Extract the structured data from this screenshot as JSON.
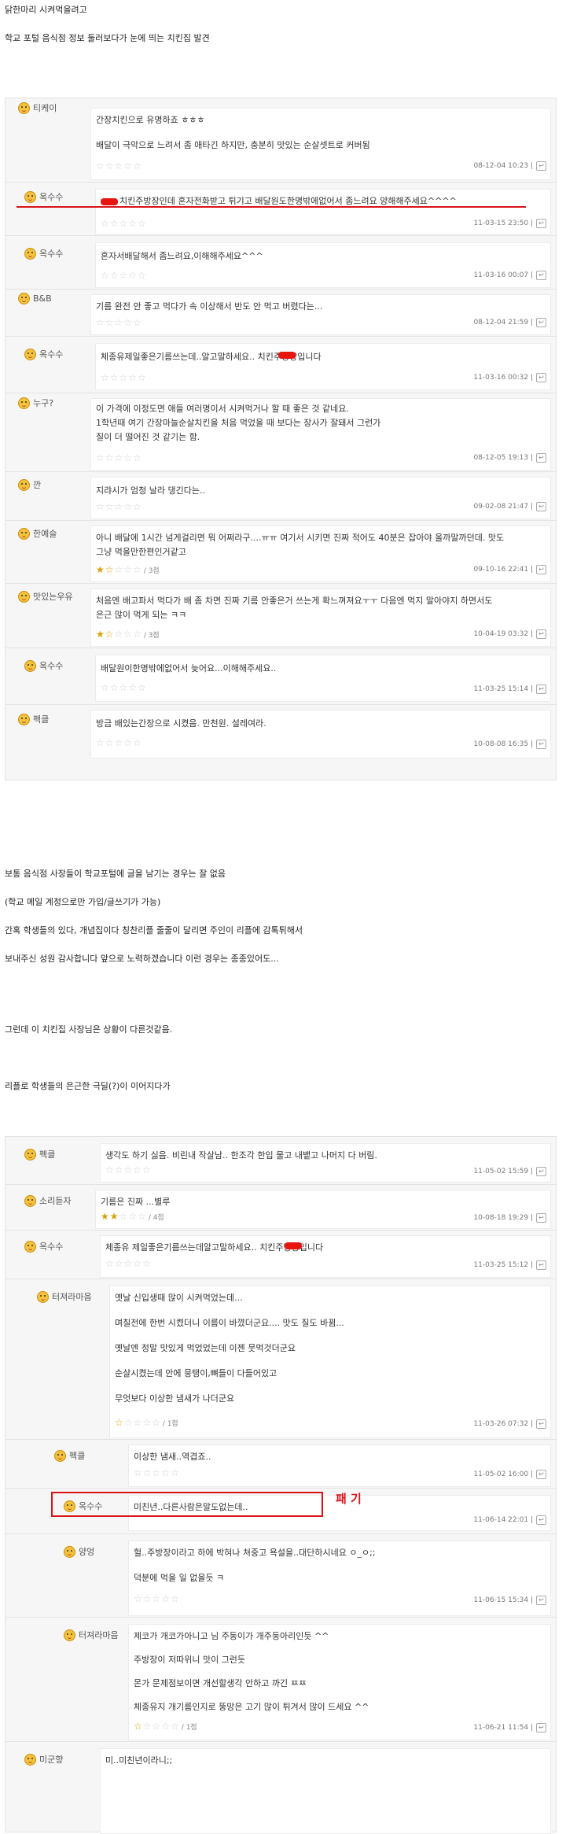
{
  "intro": {
    "line1": "닭한마리 시켜먹을려고",
    "line2": "학교 포털 음식점 정보 둘러보다가 눈에 띄는 치킨집 발견"
  },
  "board1": {
    "rows": [
      {
        "nick": "티케이",
        "lines": [
          "간장치킨으로 유명하죠 ㅎㅎㅎ",
          "배달이 극악으로 느려서 좀 애타긴 하지만, 충분히 맛있는 순살셋트로 커버됨"
        ],
        "stars": 0,
        "score": "",
        "date": "08-12-04 10:23"
      },
      {
        "nick": "옥수수",
        "lines": [
          "치킨주방장인데 혼자전화받고 튀기고 배달원도한명밖에없어서 좀느려요 양해해주세요^^^^"
        ],
        "stars": 0,
        "score": "",
        "date": "11-03-15 23:50"
      },
      {
        "nick": "옥수수",
        "lines": [
          "혼자서배달해서 좀느려요,이해해주세요^^^"
        ],
        "stars": 0,
        "score": "",
        "date": "11-03-16 00:07"
      },
      {
        "nick": "B&B",
        "lines": [
          "기름 완전 안 좋고 먹다가 속 이상해서 반도 안 먹고 버렸다는..."
        ],
        "stars": 0,
        "score": "",
        "date": "08-12-04 21:59"
      },
      {
        "nick": "옥수수",
        "lines": [
          "체종유제일좋은기름쓰는데..알고말하세요..  치킨주방장입니다"
        ],
        "stars": 0,
        "score": "",
        "date": "11-03-16 00:32"
      },
      {
        "nick": "누구?",
        "lines": [
          "이 가격에 이정도면 애들 여러명이서 시켜먹거나 할 때 좋은 것 같네요.",
          "1학년때 여기 간장마늘순살치킨을 처음 먹었을 때 보다는 장사가 잘돼서 그런가",
          "질이 더 떨어진 것 같기는 함."
        ],
        "stars": 0,
        "score": "",
        "date": "08-12-05 19:13"
      },
      {
        "nick": "깐",
        "lines": [
          "지랴시가 엄청 날라 댕긴다는.."
        ],
        "stars": 0,
        "score": "",
        "date": "09-02-08 21:47"
      },
      {
        "nick": "한예슬",
        "lines": [
          "아니 배달에 1시간 넘게걸리면 뭐 어쩌라구....ㅠㅠ 여기서 시키면 진짜 적어도 40분은 잡아야 올까말까던데. 맛도",
          "그냥 먹을만한편인거같고"
        ],
        "stars": 1.5,
        "score": "/ 3점",
        "date": "09-10-16 22:41"
      },
      {
        "nick": "맛있는우유",
        "lines": [
          "처음엔 배고파서 먹다가 배 좀 차면 진짜 기름 안좋은거 쓰는게 확느껴져요ㅜㅜ 다음엔 먹지 말아야지 하면서도",
          "은근 많이 먹게 되는 ㅋㅋ"
        ],
        "stars": 1.5,
        "score": "/ 3점",
        "date": "10-04-19 03:32"
      },
      {
        "nick": "옥수수",
        "lines": [
          "배달원이한명밖에없어서 늦어요...이해해주세요.."
        ],
        "stars": 0,
        "score": "",
        "date": "11-03-25 15:14"
      },
      {
        "nick": "펙클",
        "lines": [
          "방금 배있는간장으로 시켰음. 만천원. 설레여라."
        ],
        "stars": 0,
        "score": "",
        "date": "10-08-08 16:35"
      }
    ]
  },
  "mid": {
    "p1": "보통 음식점 사장들이 학교포털에 글을 남기는 경우는 잘 없음",
    "p2": "(학교 메일 계정으로만 가입/글쓰기가 가능)",
    "p3": "간혹 학생들의 있다, 개념집이다 칭찬리플 줄줄이 달리면 주인이 리플에 감톡튀해서",
    "p4": "보내주신 성원 감사합니다 앞으로 노력하겠습니다 이런 경우는 종종있어도...",
    "p5": "그런데 이 치킨집 사장님은 상황이 다른것같음.",
    "p6": "리플로 학생들의 은근한 극딜(?)이 이어지다가"
  },
  "board2": {
    "rows": [
      {
        "nick": "펙클",
        "lines": [
          "생각도 하기 싫음. 비린내 작살남.. 한조각 한입 물고 내뱉고 나머지 다 버림."
        ],
        "stars": 0,
        "score": "",
        "date": "11-05-02 15:59"
      },
      {
        "nick": "소리듣자",
        "lines": [
          "기름은 진짜 ...별루"
        ],
        "stars": 2,
        "score": "/ 4점",
        "date": "10-08-18 19:29"
      },
      {
        "nick": "옥수수",
        "lines": [
          "체종유 제일좋은기름쓰는데알고말하세요..  치킨주방장입니다"
        ],
        "stars": 0,
        "score": "",
        "date": "11-03-25 15:12"
      },
      {
        "nick": "터져라마음",
        "lines": [
          "옛날 신입생때 많이 시켜먹었는데...",
          "며칠전에 한번 시켰더니 이름이 바꼈더군요.... 맛도 질도 바뀜...",
          "옛날엔 정말 맛있게 먹었었는데 이젠 뭇먹것더군요",
          "순살시켰는데 안에 뭉탱이,뼈들이 다들어있고",
          "무엇보다 이상한 냄새가 나더군요"
        ],
        "stars": 0.5,
        "score": "/ 1점",
        "date": "11-03-26 07:32"
      },
      {
        "nick": "펙클",
        "lines": [
          "이상한 냄새..역겹죠.."
        ],
        "stars": 0,
        "score": "",
        "date": "11-05-02 16:00"
      },
      {
        "nick": "옥수수",
        "lines": [
          "미친년..다른사람은말도없는데.."
        ],
        "stars": 0,
        "score": "",
        "date": "11-06-14 22:01"
      },
      {
        "nick": "양엉",
        "lines": [
          "헐..주방장이라고 하에 박혀나 쳐중고 욕설을..대단하시네요 ㅇ_ㅇ;;",
          "덕분에 먹을 일 없을듯 ㅋ"
        ],
        "stars": 0,
        "score": "",
        "date": "11-06-15 15:34"
      },
      {
        "nick": "터져라마음",
        "lines": [
          "제코가 개코가아니고 님 주둥이가 개주둥아리인듯 ^^",
          "주방장이 저따위니 맛이 그런듯",
          "몬가 문제점보이면 개선할생각 안하고 까긴 ㅉㅉ",
          "체종유지 개기름인지로 뚱망은 고기 많이 튀겨서 많이 드세요 ^^"
        ],
        "stars": 0.5,
        "score": "/ 1점",
        "date": "11-06-21 11:54"
      },
      {
        "nick": "미군향",
        "lines": [
          "미..미친년이라니;;"
        ],
        "stars": 0,
        "score": "",
        "date": ""
      }
    ]
  },
  "annotation": {
    "label": "패 기"
  },
  "icons": {
    "face": "smiley-face-icon",
    "reply": "reply-icon",
    "star": "star-icon",
    "censor": "red-censor-mark"
  },
  "colors": {
    "accent": "#d8141a",
    "star": "#d8a000"
  }
}
